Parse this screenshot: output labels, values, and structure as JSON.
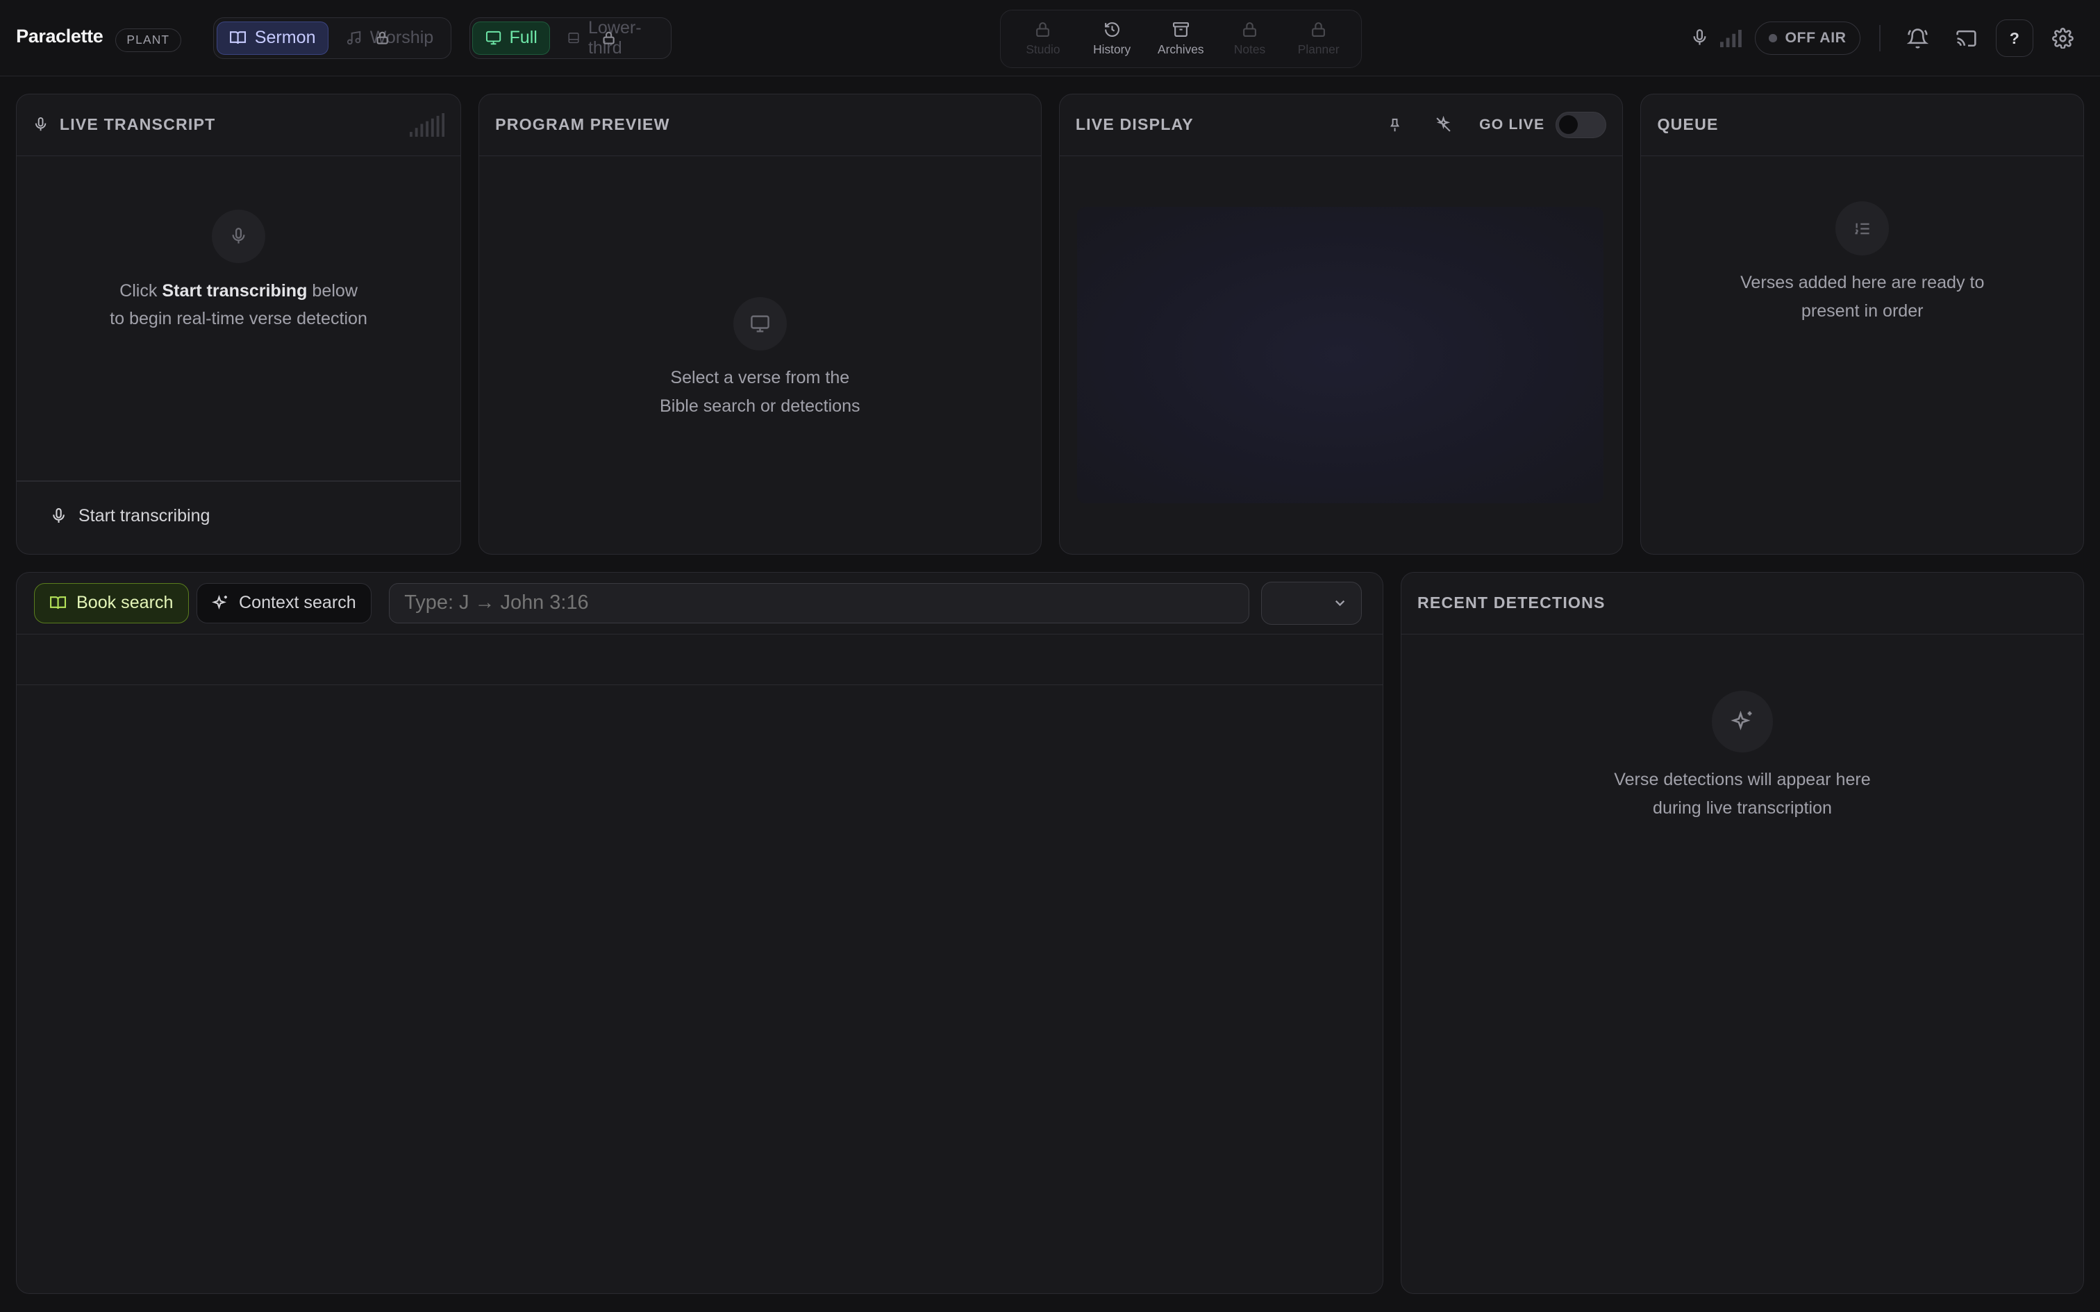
{
  "app": {
    "name": "Paraclette",
    "badge": "PLANT"
  },
  "mode_toggle": {
    "sermon": "Sermon",
    "worship": "Worship"
  },
  "layout_toggle": {
    "full": "Full",
    "lower_third": "Lower-third"
  },
  "nav": {
    "studio": "Studio",
    "history": "History",
    "archives": "Archives",
    "notes": "Notes",
    "planner": "Planner"
  },
  "status": {
    "off_air": "OFF AIR",
    "help": "?"
  },
  "transcript": {
    "title": "LIVE TRANSCRIPT",
    "empty_pre": "Click ",
    "empty_bold": "Start transcribing",
    "empty_post": " below",
    "empty_line2": "to begin real-time verse detection",
    "start_button": "Start transcribing"
  },
  "preview": {
    "title": "PROGRAM PREVIEW",
    "empty_line1": "Select a verse from the",
    "empty_line2": "Bible search or detections"
  },
  "live_display": {
    "title": "LIVE DISPLAY",
    "go_live": "GO LIVE",
    "go_live_on": false
  },
  "queue": {
    "title": "QUEUE",
    "empty_line1": "Verses added here are ready to",
    "empty_line2": "present in order"
  },
  "search": {
    "book_search": "Book search",
    "context_search": "Context search",
    "placeholder": "Type: J → John 3:16",
    "dropdown_value": ""
  },
  "detections": {
    "title": "RECENT DETECTIONS",
    "empty_line1": "Verse detections will appear here",
    "empty_line2": "during live transcription"
  },
  "colors": {
    "accent_purple": "#c7cbff",
    "accent_green": "#6ee7a8",
    "accent_lime": "#e4f5b8"
  }
}
